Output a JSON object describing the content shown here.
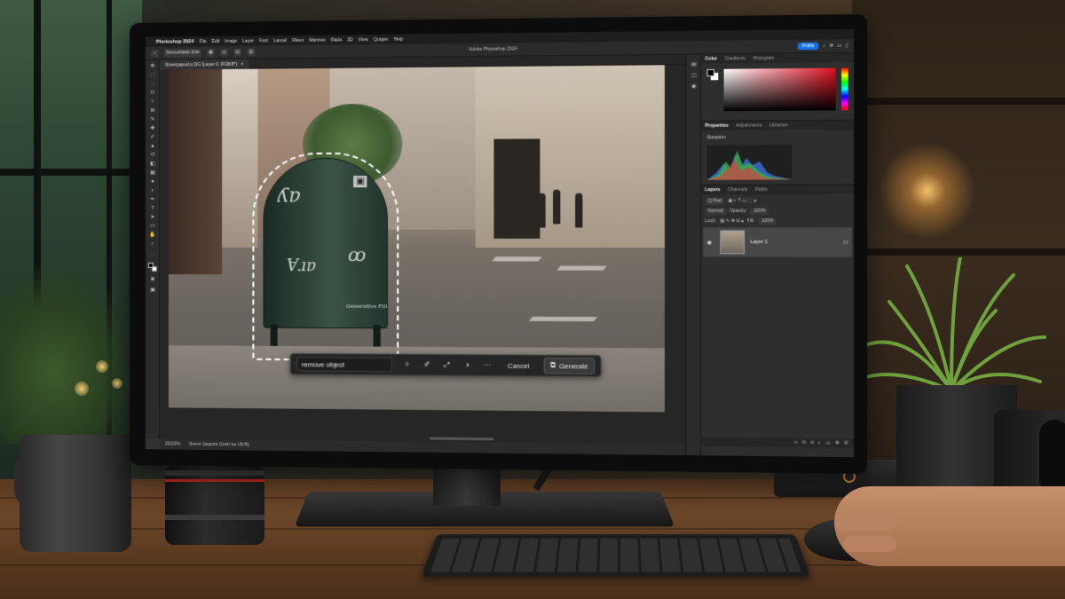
{
  "menubar": {
    "app_name": "Photoshop 2024",
    "items": [
      "File",
      "Edit",
      "Image",
      "Layer",
      "Font",
      "Lancel",
      "Rlees",
      "Mannee",
      "Rada",
      "3D",
      "View",
      "Qutges",
      "Help"
    ]
  },
  "optionsbar": {
    "preset": "Stereoblade 3cfe",
    "window_title": "Adobe Photoshop 2024",
    "share_label": "Fuhls"
  },
  "document": {
    "tab_label": "Streetyapod p.DG (Layer 0, RGB/8*)"
  },
  "canvas": {
    "graffiti_text": "Generative Fill"
  },
  "contextual_taskbar": {
    "prompt_value": "remove object",
    "cancel_label": "Cancel",
    "generate_label": "Generate",
    "more_label": "···"
  },
  "statusbar": {
    "zoom": "20/22%",
    "info": "Street Jaspore (Linin ha UK/8)"
  },
  "panels": {
    "color_tabs": [
      "Color",
      "Gradients",
      "Histogram"
    ],
    "properties_tabs": [
      "Properties",
      "Adjustments",
      "Libraries"
    ],
    "properties_label": "Stenplen",
    "layers_tabs": [
      "Layers",
      "Channels",
      "Paths"
    ],
    "layers_kind": "Q Rad",
    "blend_mode": "Normal",
    "opacity_label": "Opacity:",
    "opacity_value": "100%",
    "lock_label": "Lock:",
    "fill_label": "Fill:",
    "fill_value": "100%",
    "layer_name": "Layer 1"
  },
  "colors": {
    "accent": "#1473e6",
    "selection": "#ffffff"
  },
  "icons": {
    "toolbar": [
      "move-icon",
      "marquee-icon",
      "lasso-icon",
      "object-select-icon",
      "crop-icon",
      "frame-icon",
      "eyedropper-icon",
      "healing-icon",
      "brush-icon",
      "stamp-icon",
      "history-brush-icon",
      "eraser-icon",
      "gradient-icon",
      "blur-icon",
      "dodge-icon",
      "pen-icon",
      "type-icon",
      "path-select-icon",
      "shape-icon",
      "hand-icon",
      "zoom-icon"
    ]
  }
}
